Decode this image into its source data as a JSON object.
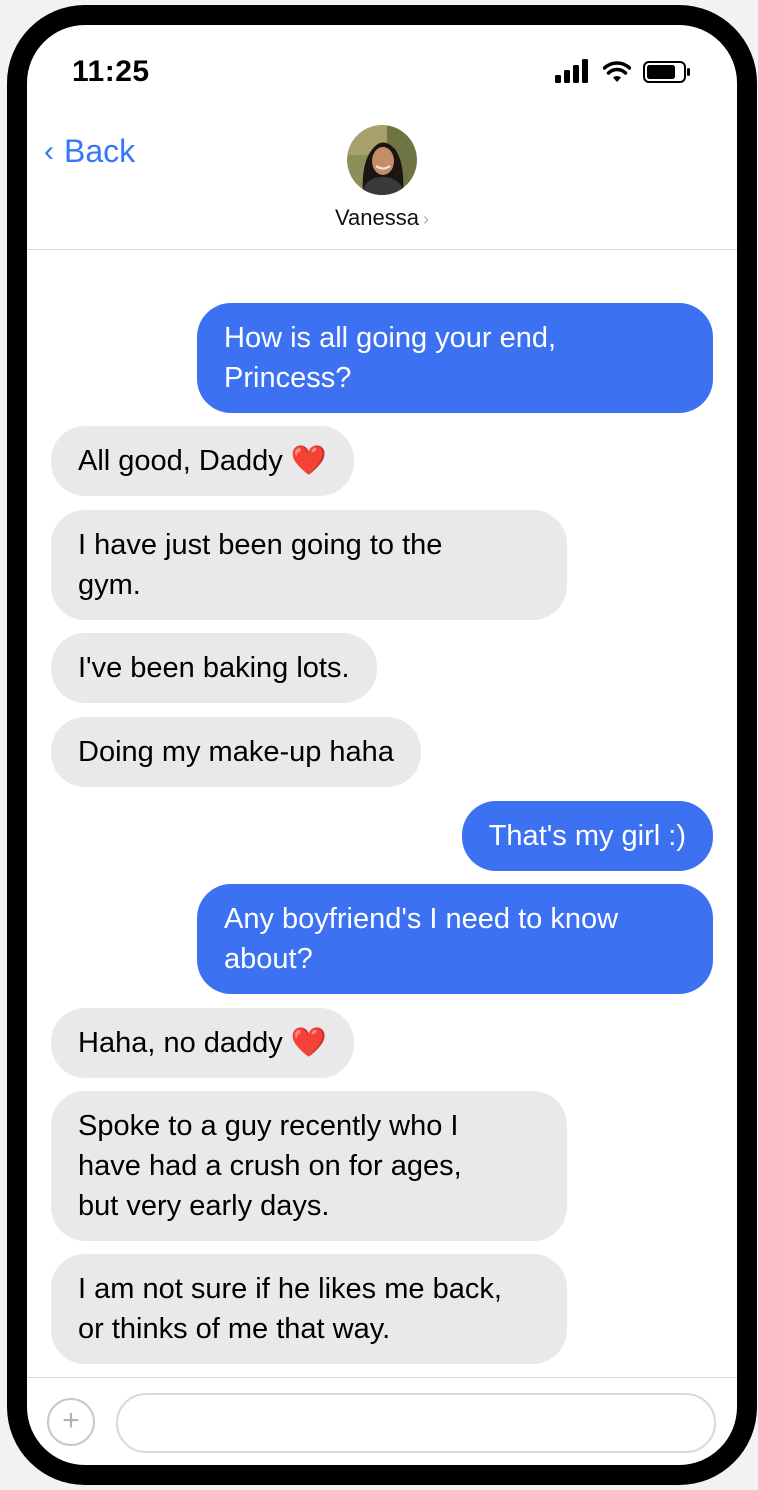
{
  "status_bar": {
    "time": "11:25",
    "icons": [
      "signal-icon",
      "wifi-icon",
      "battery-icon"
    ]
  },
  "header": {
    "back_label": "Back",
    "back_icon": "chevron-left-icon",
    "contact_name": "Vanessa",
    "contact_chevron": "›",
    "avatar_icon": "avatar-photo"
  },
  "messages": [
    {
      "from": "me",
      "text": "How is all going your end,\nPrincess?"
    },
    {
      "from": "them",
      "text": "All good, Daddy ❤️"
    },
    {
      "from": "them",
      "text": "I have just been going to the\ngym."
    },
    {
      "from": "them",
      "text": "I've been baking lots."
    },
    {
      "from": "them",
      "text": "Doing my make-up haha"
    },
    {
      "from": "me",
      "text": "That's my girl :)"
    },
    {
      "from": "me",
      "text": "Any boyfriend's I need to know\nabout?"
    },
    {
      "from": "them",
      "text": "Haha, no daddy ❤️"
    },
    {
      "from": "them",
      "text": "Spoke to a guy recently who I\nhave had a crush on for ages,\nbut very early days."
    },
    {
      "from": "them",
      "text": "I am not sure if he likes me back,\nor thinks of me that way."
    }
  ],
  "input": {
    "value": "",
    "placeholder": "",
    "plus_label": "+"
  },
  "colors": {
    "outgoing_bubble": "#3c72f2",
    "incoming_bubble": "#e9e9eb",
    "accent": "#3478f6"
  }
}
